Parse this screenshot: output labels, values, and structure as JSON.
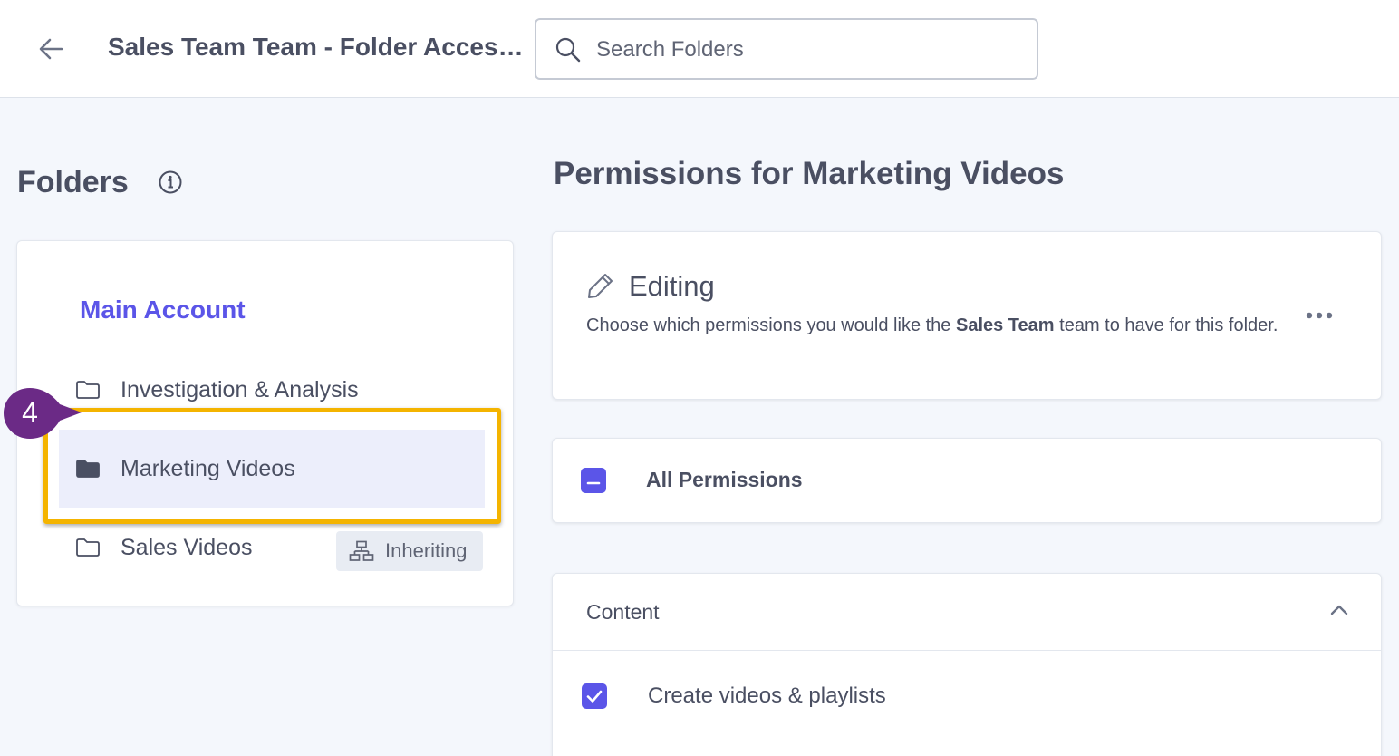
{
  "header": {
    "title": "Sales Team Team - Folder Access...",
    "search_placeholder": "Search Folders"
  },
  "sidebar": {
    "heading": "Folders",
    "root": "Main Account",
    "folders": [
      {
        "label": "Investigation & Analysis",
        "selected": false
      },
      {
        "label": "Marketing Videos",
        "selected": true
      },
      {
        "label": "Sales Videos",
        "selected": false,
        "badge": "Inheriting"
      }
    ]
  },
  "tutorial": {
    "step": "4",
    "highlight_color": "#f4b400",
    "bubble_color": "#6b2a86"
  },
  "permissions": {
    "title": "Permissions for Marketing Videos",
    "editing": {
      "title": "Editing",
      "desc_prefix": "Choose which permissions you would like the ",
      "desc_team": "Sales Team",
      "desc_suffix": " team to have for this folder."
    },
    "all_label": "All Permissions",
    "sections": [
      {
        "label": "Content",
        "expanded": true,
        "items": [
          {
            "label": "Create videos & playlists",
            "checked": true
          }
        ]
      }
    ]
  },
  "colors": {
    "accent": "#5b55e8",
    "text": "#4a4f62",
    "background": "#f4f7fc"
  }
}
